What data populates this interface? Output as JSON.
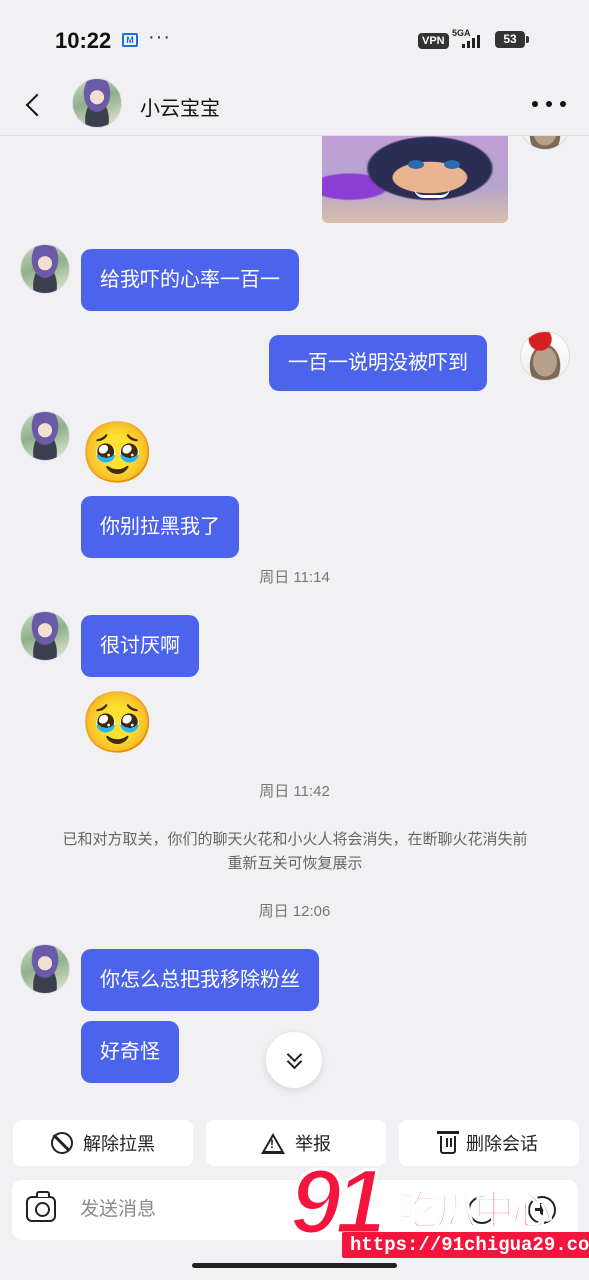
{
  "status_bar": {
    "time": "10:22",
    "mail_icon": "M",
    "dots": "···",
    "vpn": "VPN",
    "network": "5GA",
    "battery": "53"
  },
  "header": {
    "title": "小云宝宝"
  },
  "messages": [
    {
      "type": "incoming",
      "text": "给我吓的心率一百一"
    },
    {
      "type": "outgoing",
      "text": "一百一说明没被吓到"
    },
    {
      "type": "incoming-emoji",
      "emoji": "🥹"
    },
    {
      "type": "incoming",
      "text": "你别拉黑我了"
    },
    {
      "type": "time",
      "text": "周日 11:14"
    },
    {
      "type": "incoming",
      "text": "很讨厌啊"
    },
    {
      "type": "incoming-emoji",
      "emoji": "🥹"
    },
    {
      "type": "time",
      "text": "周日 11:42"
    },
    {
      "type": "system",
      "text": "已和对方取关，你们的聊天火花和小火人将会消失，在断聊火花消失前重新互关可恢复展示"
    },
    {
      "type": "time",
      "text": "周日 12:06"
    },
    {
      "type": "incoming",
      "text": "你怎么总把我移除粉丝"
    },
    {
      "type": "incoming",
      "text": "好奇怪"
    }
  ],
  "actions": {
    "unblock": "解除拉黑",
    "report": "举报",
    "delete_chat": "删除会话"
  },
  "composer": {
    "placeholder": "发送消息",
    "value": ""
  },
  "watermark": {
    "number": "91",
    "text": "吃瓜中心",
    "url": "https://91chigua29.com"
  },
  "colors": {
    "bubble": "#4c63ec",
    "background": "#f1f1f3",
    "watermark": "#f5143c"
  }
}
